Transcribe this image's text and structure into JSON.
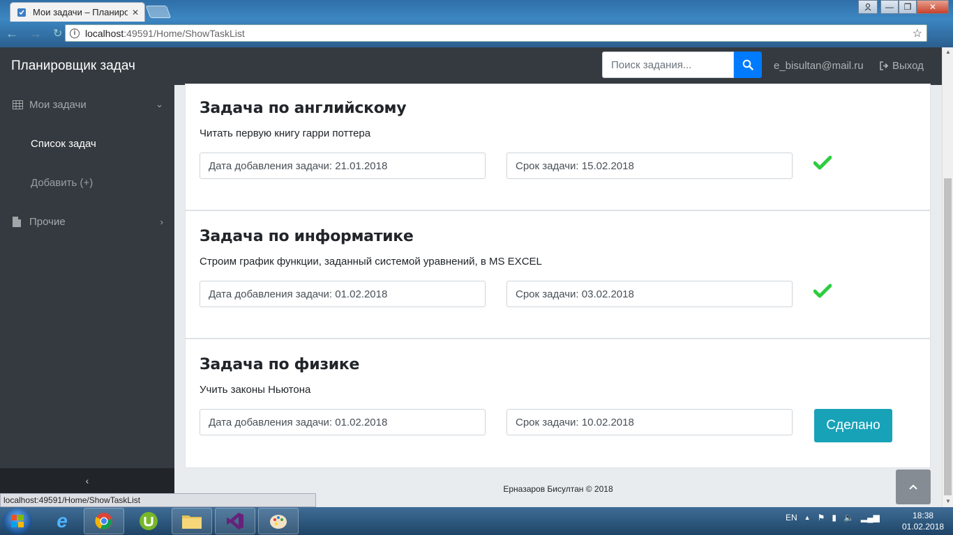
{
  "browser": {
    "tab_title": "Мои задачи – Планиров",
    "url_host": "localhost",
    "url_path": ":49591/Home/ShowTaskList",
    "status_url": "localhost:49591/Home/ShowTaskList"
  },
  "navbar": {
    "brand": "Планировщик задач",
    "search_placeholder": "Поиск задания...",
    "user_email": "e_bisultan@mail.ru",
    "logout_label": "Выход"
  },
  "sidebar": {
    "my_tasks": "Мои задачи",
    "task_list": "Список задач",
    "add_task": "Добавить (+)",
    "other": "Прочие",
    "collapse_icon": "chevron-left-icon"
  },
  "tasks": [
    {
      "title": "Задача по английскому",
      "description": "Читать первую книгу гарри поттера",
      "added": "Дата добавления задачи: 21.01.2018",
      "deadline": "Срок задачи: 15.02.2018",
      "status": "done"
    },
    {
      "title": "Задача по информатике",
      "description": "Строим график функции, заданный системой уравнений, в MS EXCEL",
      "added": "Дата добавления задачи: 01.02.2018",
      "deadline": "Срок задачи: 03.02.2018",
      "status": "done"
    },
    {
      "title": "Задача по физике",
      "description": "Учить законы Ньютона",
      "added": "Дата добавления задачи: 01.02.2018",
      "deadline": "Срок задачи: 10.02.2018",
      "status": "pending",
      "button_label": "Сделано"
    }
  ],
  "footer": {
    "text": "Ерназаров Бисултан © 2018"
  },
  "taskbar": {
    "lang": "EN",
    "time": "18:38",
    "date": "01.02.2018"
  },
  "colors": {
    "navbar": "#343a40",
    "primary": "#007bff",
    "info": "#17a2b8",
    "success_check": "#2ecc40"
  }
}
